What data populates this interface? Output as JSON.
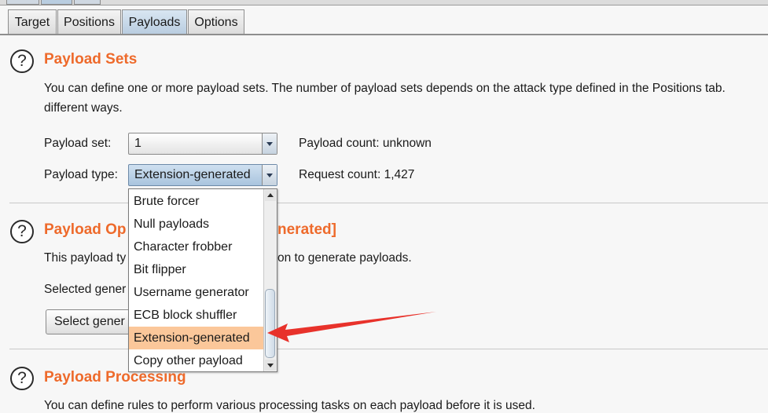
{
  "tabs": [
    {
      "label": "Target"
    },
    {
      "label": "Positions"
    },
    {
      "label": "Payloads",
      "active": true
    },
    {
      "label": "Options"
    }
  ],
  "payload_sets": {
    "title": "Payload Sets",
    "description_line1": "You can define one or more payload sets. The number of payload sets depends on the attack type defined in the Positions tab.",
    "description_line2": "different ways.",
    "set_label": "Payload set:",
    "set_value": "1",
    "type_label": "Payload type:",
    "type_value": "Extension-generated",
    "payload_count": "Payload count: unknown",
    "request_count": "Request count: 1,427"
  },
  "payload_options": {
    "title_left": "Payload Op",
    "title_right": "nerated]",
    "desc_left": "This payload ty",
    "desc_right": "on to generate payloads.",
    "selected_label": "Selected gener",
    "select_button": "Select gener"
  },
  "payload_processing": {
    "title": "Payload Processing",
    "description": "You can define rules to perform various processing tasks on each payload before it is used."
  },
  "dropdown": {
    "items": [
      "Brute forcer",
      "Null payloads",
      "Character frobber",
      "Bit flipper",
      "Username generator",
      "ECB block shuffler",
      "Extension-generated",
      "Copy other payload"
    ],
    "selected": "Extension-generated"
  },
  "help_icon": "?",
  "colors": {
    "heading": "#ee6a2b",
    "selected_item": "#fbc79a",
    "annotation_arrow": "#e8322b"
  }
}
